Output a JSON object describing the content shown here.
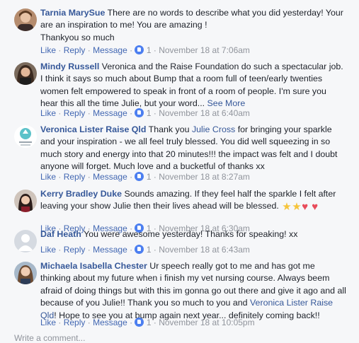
{
  "actions": {
    "like": "Like",
    "reply": "Reply",
    "message": "Message",
    "dot": "·"
  },
  "comments": [
    {
      "author": "Tarnia MarySue",
      "text_1": "There are no words to describe what you did yesterday! Your are an inspiration to me! You are amazing !",
      "text_2": "Thankyou so much",
      "likes": "1",
      "time": "November 18 at 7:06am"
    },
    {
      "author": "Mindy Russell",
      "text": "Veronica and the Raise Foundation do such a spectacular job. I think it says so much about Bump that a room full of teen/early twenties women felt empowered to speak in front of a room of people. I'm sure you hear this all the time Julie, but your word...",
      "see_more": "See More",
      "likes": "1",
      "time": "November 18 at 6:40am"
    },
    {
      "author": "Veronica Lister Raise Qld",
      "text_pre": "Thank you ",
      "mention": "Julie Cross",
      "text_post": " for bringing your sparkle and your inspiration - we all feel truly blessed. You did well squeezing in so much story and energy into that 20 minutes!!! the impact was felt and I doubt anyone will forget. Much love and a bucketful of thanks xx",
      "likes": "1",
      "time": "November 18 at 8:27am"
    },
    {
      "author": "Kerry Bradley Duke",
      "text": "Sounds amazing. If they feel half the sparkle I felt after leaving your show Julie then their lives ahead will be blessed.",
      "emojis": [
        "star",
        "star",
        "heart",
        "heart"
      ],
      "likes": "1",
      "time": "November 18 at 6:30am"
    },
    {
      "author": "Daf Heath",
      "text": "You were awesome yesterday! Thanks for speaking! xx",
      "likes": "1",
      "time": "November 18 at 6:43am"
    },
    {
      "author": "Michaela Isabella Chester",
      "text_pre": "Ur speech really got to me and has got me thinking about my future when i finish my vet nursing course. Always beem afraid of doing things but with this im gonna go out there and give it ago and all because of you Julie!! Thank you so much to you and ",
      "mention": "Veronica Lister Raise Qld",
      "text_post": "! Hope to see you at bump again next year... definitely coming back!!",
      "likes": "1",
      "time": "November 18 at 10:05pm"
    }
  ],
  "footer": {
    "write_comment": "Write a comment..."
  }
}
